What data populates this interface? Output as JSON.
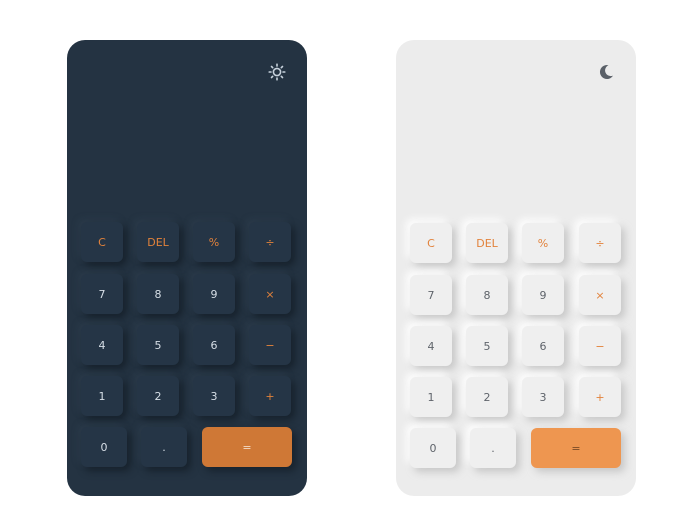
{
  "calculators": {
    "dark": {
      "theme_icon": "sun-icon",
      "display_value": "",
      "keys": {
        "clear": "C",
        "delete": "DEL",
        "percent": "%",
        "divide": "÷",
        "seven": "7",
        "eight": "8",
        "nine": "9",
        "multiply": "×",
        "four": "4",
        "five": "5",
        "six": "6",
        "minus": "−",
        "one": "1",
        "two": "2",
        "three": "3",
        "plus": "+",
        "zero": "0",
        "decimal": ".",
        "equals": "="
      }
    },
    "light": {
      "theme_icon": "moon-icon",
      "display_value": "",
      "keys": {
        "clear": "C",
        "delete": "DEL",
        "percent": "%",
        "divide": "÷",
        "seven": "7",
        "eight": "8",
        "nine": "9",
        "multiply": "×",
        "four": "4",
        "five": "5",
        "six": "6",
        "minus": "−",
        "one": "1",
        "two": "2",
        "three": "3",
        "plus": "+",
        "zero": "0",
        "decimal": ".",
        "equals": "="
      }
    }
  },
  "colors": {
    "dark_background": "#243342",
    "light_background": "#ececec",
    "accent_orange": "#e2823b",
    "equals_dark": "#cf7836",
    "equals_light": "#ee9650"
  }
}
